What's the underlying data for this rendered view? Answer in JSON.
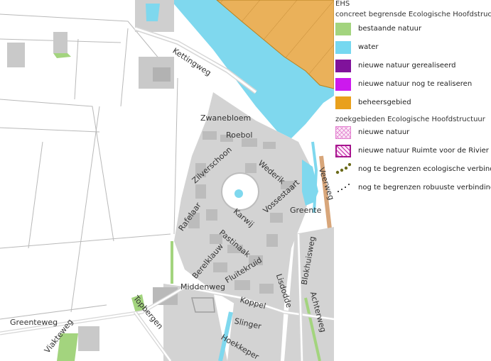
{
  "map": {
    "streets": [
      "Kettingweg",
      "Zwanebloem",
      "Roebol",
      "Zilverschoon",
      "Wederik",
      "Veerweg",
      "Vossestaart",
      "Greente",
      "Karwij",
      "Rafelaar",
      "Pastinaak",
      "Berelklauw",
      "Fluitekruid",
      "Blokhuisweg",
      "Lisdodde",
      "Middenweg",
      "Koppel",
      "Achterweg",
      "Topbergen",
      "Greenteweg",
      "Slinger",
      "Viakteweg",
      "Hoekkeper"
    ]
  },
  "legend": {
    "section1_title": "EHS",
    "section1_subtitle": "concreet begrensde Ecologische Hoofdstructuur",
    "items1": [
      {
        "label": "bestaande natuur",
        "color": "#a3d47e"
      },
      {
        "label": "water",
        "color": "#76d8f0"
      },
      {
        "label": "nieuwe natuur gerealiseerd",
        "color": "#80129b"
      },
      {
        "label": "nieuwe natuur nog te realiseren",
        "color": "#cc19ee"
      },
      {
        "label": "beheersgebied",
        "color": "#e9a01c"
      }
    ],
    "section2_title": "zoekgebieden Ecologische Hoofdstructuur",
    "items2": [
      {
        "label": "nieuwe natuur",
        "icon": "pink-hatch-swatch"
      },
      {
        "label": "nieuwe natuur Ruimte voor de Rivier",
        "icon": "magenta-hatch-swatch"
      },
      {
        "label": "nog te begrenzen ecologische verbindingszone",
        "icon": "olive-dots-swatch"
      },
      {
        "label": "nog te begrenzen robuuste verbinding",
        "icon": "black-dots-swatch"
      }
    ]
  }
}
